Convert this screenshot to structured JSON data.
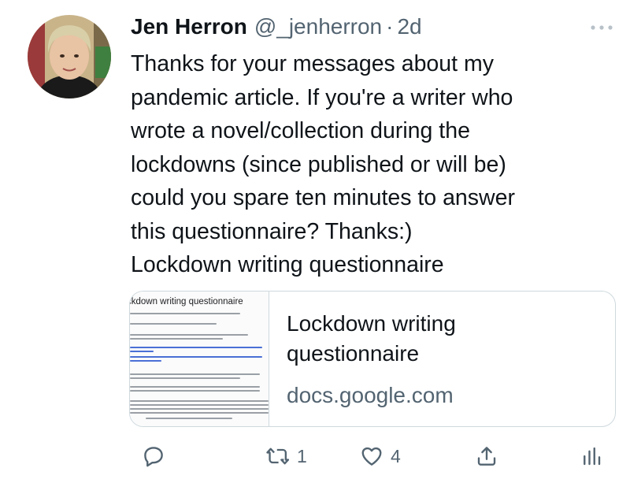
{
  "tweet": {
    "author_name": "Jen Herron",
    "author_handle": "@_jenherron",
    "separator": "·",
    "time": "2d",
    "more_icon": "ellipsis-icon",
    "text_lines": [
      "Thanks for your messages about my",
      "pandemic article. If you're a writer who",
      "wrote a novel/collection during the",
      "lockdowns (since published or will be)",
      "could you spare ten minutes to answer",
      "this questionnaire?  Thanks:)",
      "Lockdown writing questionnaire"
    ]
  },
  "card": {
    "thumbnail_title": "ckdown writing questionnaire",
    "title": "Lockdown writing questionnaire",
    "domain": "docs.google.com"
  },
  "actions": {
    "reply": {
      "icon": "reply-icon",
      "count": ""
    },
    "retweet": {
      "icon": "retweet-icon",
      "count": "1"
    },
    "like": {
      "icon": "heart-icon",
      "count": "4"
    },
    "share": {
      "icon": "share-icon"
    },
    "analytics": {
      "icon": "analytics-icon"
    }
  },
  "colors": {
    "text": "#0f1419",
    "secondary": "#536471",
    "border": "#cfd9de"
  }
}
